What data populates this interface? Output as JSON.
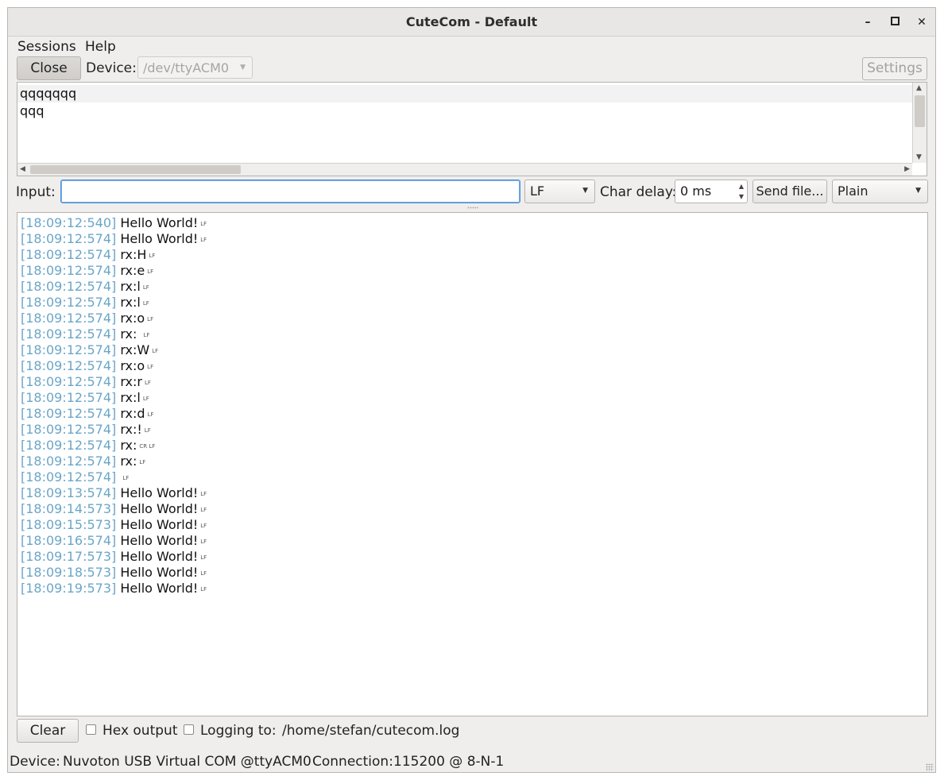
{
  "window": {
    "title": "CuteCom - Default",
    "minimize_glyph": "–",
    "maximize_glyph": "▫",
    "close_glyph": "✕"
  },
  "menu": {
    "sessions": "Sessions",
    "help": "Help"
  },
  "toolbar": {
    "close_label": "Close",
    "device_label": "Device:",
    "device_value": "/dev/ttyACM0",
    "settings_label": "Settings"
  },
  "sent_history": [
    "qqqqqqq",
    "qqq"
  ],
  "input_bar": {
    "input_label": "Input:",
    "input_value": "",
    "line_ending": "LF",
    "char_delay_label": "Char delay:",
    "char_delay_value": "0 ms",
    "send_file_label": "Send file...",
    "format": "Plain"
  },
  "log": [
    {
      "ts": "[18:09:12:540]",
      "msg": "Hello World!",
      "lf": "LF"
    },
    {
      "ts": "[18:09:12:574]",
      "msg": "Hello World!",
      "lf": "LF"
    },
    {
      "ts": "[18:09:12:574]",
      "msg": "rx:H",
      "lf": "LF"
    },
    {
      "ts": "[18:09:12:574]",
      "msg": "rx:e",
      "lf": "LF"
    },
    {
      "ts": "[18:09:12:574]",
      "msg": "rx:l",
      "lf": "LF"
    },
    {
      "ts": "[18:09:12:574]",
      "msg": "rx:l",
      "lf": "LF"
    },
    {
      "ts": "[18:09:12:574]",
      "msg": "rx:o",
      "lf": "LF"
    },
    {
      "ts": "[18:09:12:574]",
      "msg": "rx: ",
      "lf": "LF"
    },
    {
      "ts": "[18:09:12:574]",
      "msg": "rx:W",
      "lf": "LF"
    },
    {
      "ts": "[18:09:12:574]",
      "msg": "rx:o",
      "lf": "LF"
    },
    {
      "ts": "[18:09:12:574]",
      "msg": "rx:r",
      "lf": "LF"
    },
    {
      "ts": "[18:09:12:574]",
      "msg": "rx:l",
      "lf": "LF"
    },
    {
      "ts": "[18:09:12:574]",
      "msg": "rx:d",
      "lf": "LF"
    },
    {
      "ts": "[18:09:12:574]",
      "msg": "rx:!",
      "lf": "LF"
    },
    {
      "ts": "[18:09:12:574]",
      "msg": "rx:",
      "lf": "CR LF"
    },
    {
      "ts": "[18:09:12:574]",
      "msg": "rx:",
      "lf": "LF"
    },
    {
      "ts": "[18:09:12:574]",
      "msg": "",
      "lf": "LF"
    },
    {
      "ts": "[18:09:13:574]",
      "msg": "Hello World!",
      "lf": "LF"
    },
    {
      "ts": "[18:09:14:573]",
      "msg": "Hello World!",
      "lf": "LF"
    },
    {
      "ts": "[18:09:15:573]",
      "msg": "Hello World!",
      "lf": "LF"
    },
    {
      "ts": "[18:09:16:574]",
      "msg": "Hello World!",
      "lf": "LF"
    },
    {
      "ts": "[18:09:17:573]",
      "msg": "Hello World!",
      "lf": "LF"
    },
    {
      "ts": "[18:09:18:573]",
      "msg": "Hello World!",
      "lf": "LF"
    },
    {
      "ts": "[18:09:19:573]",
      "msg": "Hello World!",
      "lf": "LF"
    }
  ],
  "bottom_bar": {
    "clear_label": "Clear",
    "hex_output_label": "Hex output",
    "hex_output_checked": false,
    "logging_label": "Logging to:",
    "logging_checked": false,
    "log_path": "/home/stefan/cutecom.log"
  },
  "status": {
    "device_label": "Device:",
    "device_value": "Nuvoton USB Virtual COM @ttyACM0",
    "connection_label": "Connection:",
    "connection_value": "115200 @ 8-N-1"
  },
  "colors": {
    "timestamp": "#6aa6c8",
    "focus_border": "#4a90d9"
  }
}
